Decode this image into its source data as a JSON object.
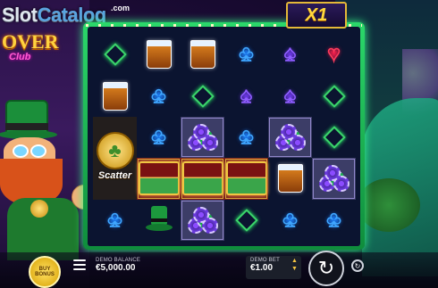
{
  "watermark": {
    "brand_part1": "Slot",
    "brand_part2": "Catalog",
    "suffix": ".com"
  },
  "game_logo": {
    "word": "OVER",
    "club": "Club"
  },
  "multiplier": "X1",
  "grid": [
    [
      "diamond",
      "whisky",
      "whisky",
      "club",
      "spade",
      "heart"
    ],
    [
      "whisky",
      "club",
      "diamond",
      "spade",
      "spade",
      "diamond"
    ],
    [
      "scatter",
      "club",
      "chips",
      "club",
      "chips",
      "diamond"
    ],
    [
      "scatter",
      "cash",
      "cash",
      "cash",
      "whisky",
      "chips"
    ],
    [
      "club",
      "tophat",
      "chips",
      "diamond",
      "club",
      "club"
    ]
  ],
  "scatter_label": "Scatter",
  "buy_bonus": {
    "line1": "BUY",
    "line2": "BONUS"
  },
  "balance": {
    "label": "DEMO BALANCE",
    "value": "€5,000.00"
  },
  "bet": {
    "label": "DEMO BET",
    "value": "€1.00"
  },
  "icons": {
    "menu": "hamburger-icon",
    "spin": "spin-arrow-icon",
    "auto": "autoplay-icon",
    "up": "arrow-up-icon",
    "down": "arrow-down-icon"
  },
  "colors": {
    "frame": "#2bd86a",
    "gold": "#ffd83c",
    "club": "#3fa6ff",
    "spade": "#8e5cff",
    "heart": "#ff3b5c",
    "diamond": "#3bd66b"
  }
}
